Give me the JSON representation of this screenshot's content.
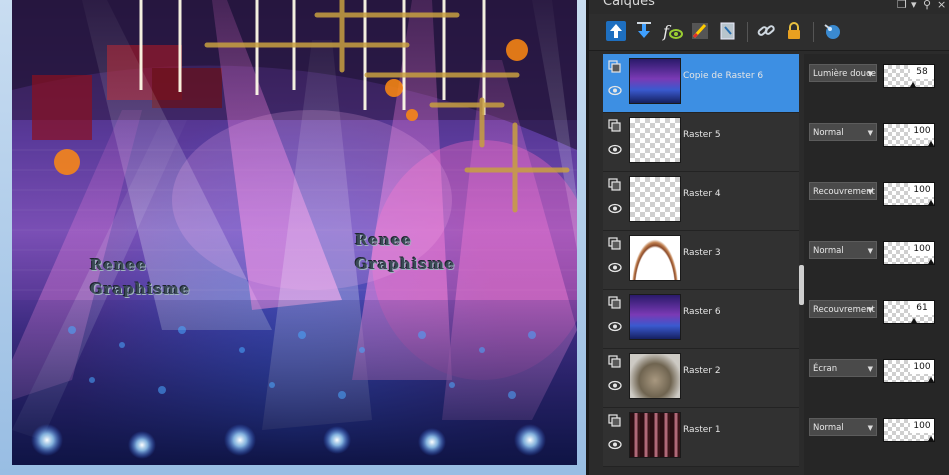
{
  "panel": {
    "title": "Calques"
  },
  "toolbar": {
    "icons": [
      "move-layer-up-icon",
      "move-layer-down-icon",
      "visibility-toggle-icon",
      "edit-mask-icon",
      "lock-icon-pencil",
      "link-icon",
      "lock-icon",
      "ball-icon"
    ]
  },
  "canvas": {
    "watermark_1_line1": "Renee",
    "watermark_1_line2": "Graphisme",
    "watermark_2_line1": "Renee",
    "watermark_2_line2": "Graphisme"
  },
  "layers": [
    {
      "name": "Copie de Raster 6",
      "blend": "Lumière douce",
      "opacity": "58",
      "opacity_value": 58,
      "selected": true,
      "thumb": "stage"
    },
    {
      "name": "Raster 5",
      "blend": "Normal",
      "opacity": "100",
      "opacity_value": 100,
      "selected": false,
      "thumb": "empty"
    },
    {
      "name": "Raster 4",
      "blend": "Recouvrement",
      "opacity": "100",
      "opacity_value": 100,
      "selected": false,
      "thumb": "empty"
    },
    {
      "name": "Raster 3",
      "blend": "Normal",
      "opacity": "100",
      "opacity_value": 100,
      "selected": false,
      "thumb": "arc"
    },
    {
      "name": "Raster 6",
      "blend": "Recouvrement",
      "opacity": "61",
      "opacity_value": 61,
      "selected": false,
      "thumb": "stage"
    },
    {
      "name": "Raster 2",
      "blend": "Écran",
      "opacity": "100",
      "opacity_value": 100,
      "selected": false,
      "thumb": "smoke"
    },
    {
      "name": "Raster 1",
      "blend": "Normal",
      "opacity": "100",
      "opacity_value": 100,
      "selected": false,
      "thumb": "curtain"
    }
  ],
  "colors": {
    "selected_row": "#3d8fe3",
    "panel_bg": "#2b2b2b",
    "canvas_frame": "#98bde3"
  }
}
